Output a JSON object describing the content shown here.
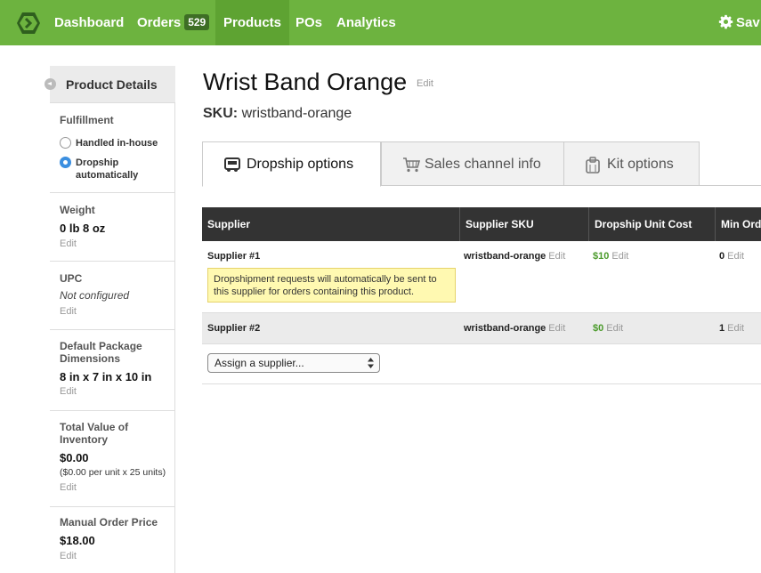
{
  "nav": {
    "items": [
      {
        "label": "Dashboard"
      },
      {
        "label": "Orders",
        "badge": "529"
      },
      {
        "label": "Products"
      },
      {
        "label": "POs"
      },
      {
        "label": "Analytics"
      }
    ],
    "settings_label": "Sav",
    "active_color": "#5ea332",
    "brand_color": "#6db33f"
  },
  "sidebar": {
    "title": "Product Details",
    "fulfillment": {
      "label": "Fulfillment",
      "options": [
        {
          "label": "Handled in-house",
          "selected": false
        },
        {
          "label": "Dropship automatically",
          "selected": true
        }
      ]
    },
    "weight": {
      "label": "Weight",
      "value": "0 lb 8 oz",
      "edit": "Edit"
    },
    "upc": {
      "label": "UPC",
      "value": "Not configured",
      "edit": "Edit"
    },
    "dimensions": {
      "label": "Default Package Dimensions",
      "value": "8 in x 7 in x 10 in",
      "edit": "Edit"
    },
    "inventory": {
      "label": "Total Value of Inventory",
      "value": "$0.00",
      "detail": "($0.00 per unit x 25 units)",
      "edit": "Edit"
    },
    "manual_price": {
      "label": "Manual Order Price",
      "value": "$18.00",
      "edit": "Edit"
    }
  },
  "product": {
    "title": "Wrist Band Orange",
    "title_edit": "Edit",
    "sku_label": "SKU:",
    "sku": "wristband-orange"
  },
  "tabs": [
    {
      "label": "Dropship options",
      "icon": "truck-icon",
      "active": true
    },
    {
      "label": "Sales channel info",
      "icon": "cart-icon",
      "active": false
    },
    {
      "label": "Kit options",
      "icon": "clipboard-icon",
      "active": false
    }
  ],
  "table": {
    "columns": [
      "Supplier",
      "Supplier SKU",
      "Dropship Unit Cost",
      "Min Ord"
    ],
    "rows": [
      {
        "supplier": "Supplier #1",
        "sku": "wristband-orange",
        "cost": "$10",
        "min": "0",
        "edit": "Edit",
        "note": "Dropshipment requests will automatically be sent to this supplier for orders containing this product."
      },
      {
        "supplier": "Supplier #2",
        "sku": "wristband-orange",
        "cost": "$0",
        "min": "1",
        "edit": "Edit"
      }
    ],
    "assign_placeholder": "Assign a supplier..."
  }
}
